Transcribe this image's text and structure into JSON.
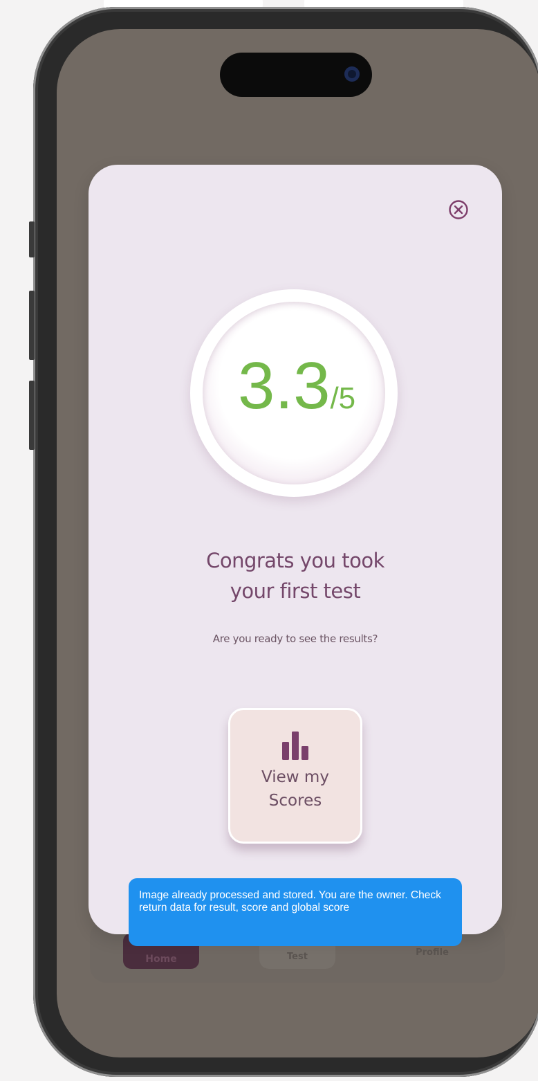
{
  "tabbar": {
    "home_label": "Home",
    "test_label": "Test",
    "profile_label": "Profile"
  },
  "modal": {
    "close_icon": "circle-x-icon",
    "score": {
      "value": "3.3",
      "max": "/5",
      "color": "#74b84a"
    },
    "title_line1": "Congrats you took",
    "title_line2": "your first test",
    "subtitle": "Are you ready to see the results?",
    "view_scores_button": {
      "icon": "bar-chart-icon",
      "label_line1": "View my",
      "label_line2": "Scores"
    }
  },
  "toast": {
    "message": "Image already processed and stored. You are the owner. Check return data for result, score and global score",
    "color": "#1f91ef"
  },
  "colors": {
    "screen_background": "#726a63",
    "modal_background": "#ede6ef",
    "accent_purple": "#74476a"
  }
}
